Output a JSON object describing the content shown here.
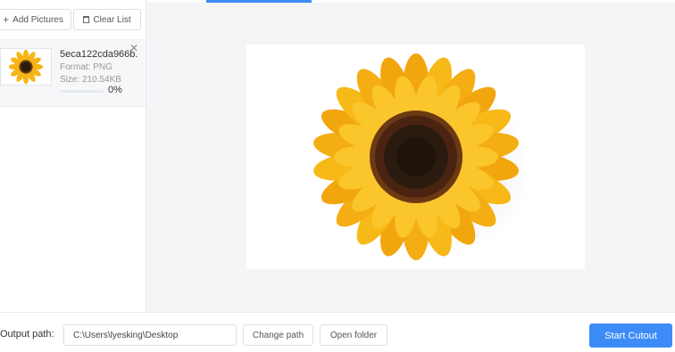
{
  "toolbar": {
    "add_label": "Add Pictures",
    "clear_label": "Clear List"
  },
  "file": {
    "name": "5eca122cda966b...",
    "format": "Format:  PNG",
    "size": "Size:  210.54KB",
    "progress_percent": 0,
    "progress_label": "0%"
  },
  "output": {
    "label": "Output path:",
    "path": "C:\\Users\\lyesking\\Desktop",
    "change_label": "Change path",
    "open_label": "Open folder"
  },
  "start_label": "Start Cutout",
  "colors": {
    "accent": "#3d8bf7",
    "petal": "#f6b516",
    "center": "#3a2213"
  },
  "icons": [
    "plus-icon",
    "trash-icon",
    "close-icon"
  ]
}
